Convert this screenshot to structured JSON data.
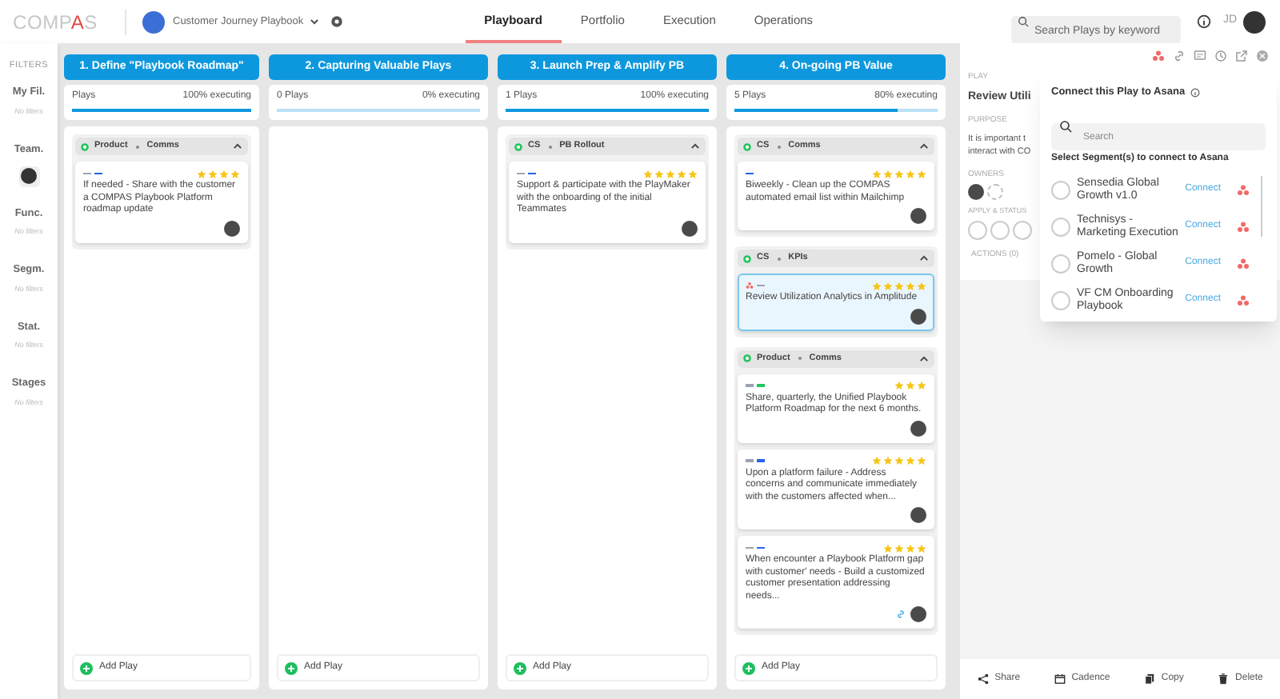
{
  "topbar": {
    "logo": [
      {
        "text": "COMP",
        "accent": false
      },
      {
        "text": "A",
        "accent": true
      },
      {
        "text": "S",
        "accent": false
      }
    ],
    "playbook": "Customer Journey Playbook",
    "tabs": [
      {
        "label": "Playboard",
        "selected": true
      },
      {
        "label": "Portfolio",
        "selected": false
      },
      {
        "label": "Execution",
        "selected": false
      },
      {
        "label": "Operations",
        "selected": false
      }
    ],
    "search": {
      "placeholder": "Search Plays by keyword"
    },
    "user_initials": "JD"
  },
  "filters": {
    "title": "FILTERS",
    "sections": [
      {
        "label": "My Fil.",
        "value": "No filters",
        "kind": "text"
      },
      {
        "label": "Team.",
        "kind": "avatar"
      },
      {
        "label": "Func.",
        "value": "No filters",
        "kind": "text"
      },
      {
        "label": "Segm.",
        "value": "No filters",
        "kind": "text"
      },
      {
        "label": "Stat.",
        "value": "No filters",
        "kind": "text"
      },
      {
        "label": "Stages",
        "value": "No filters",
        "kind": "text"
      }
    ]
  },
  "columns": [
    {
      "title": "1. Define \"Playbook Roadmap\"",
      "plays": "Plays",
      "executing": "100% executing",
      "level": 1,
      "add": "Add Play",
      "groups": [
        {
          "team": "Product",
          "area": "Comms",
          "expanded": true,
          "cards": [
            {
              "markers": [
                {
                  "color": "#9ca3af"
                },
                {
                  "color": "#2563eb"
                }
              ],
              "stars": 4,
              "text": "If needed - Share with the customer a COMPAS Playbook Platform roadmap update",
              "selected": false,
              "asana": false,
              "linked": false
            }
          ]
        }
      ]
    },
    {
      "title": "2. Capturing Valuable Plays",
      "plays": "0 Plays",
      "executing": "0% executing",
      "level": 0,
      "add": "Add Play"
    },
    {
      "title": "3. Launch Prep & Amplify PB",
      "plays": "1 Plays",
      "executing": "100% executing",
      "level": 1,
      "add": "Add Play",
      "groups": [
        {
          "team": "CS",
          "area": "PB Rollout",
          "expanded": true,
          "cards": [
            {
              "markers": [
                {
                  "color": "#9ca3af"
                },
                {
                  "color": "#2563eb"
                }
              ],
              "stars": 5,
              "text": "Support & participate with the PlayMaker with the onboarding of the initial Teammates",
              "selected": false,
              "asana": false,
              "linked": false
            }
          ]
        }
      ]
    },
    {
      "title": "4. On-going PB Value",
      "plays": "5 Plays",
      "executing": "80% executing",
      "level": 0.8,
      "add": "Add Play",
      "groups": [
        {
          "team": "CS",
          "area": "Comms",
          "expanded": true,
          "cards": [
            {
              "markers": [
                {
                  "color": "#2563eb"
                }
              ],
              "stars": 5,
              "text": "Biweekly - Clean up the COMPAS automated email list within Mailchimp",
              "selected": false,
              "asana": false,
              "linked": false
            }
          ]
        },
        {
          "team": "CS",
          "area": "KPIs",
          "expanded": true,
          "cards": [
            {
              "markers": [
                {
                  "color": "#9ca3af"
                }
              ],
              "stars": 5,
              "text": "Review Utilization Analytics in Amplitude",
              "selected": true,
              "asana": true,
              "linked": false
            }
          ]
        },
        {
          "team": "Product",
          "area": "Comms",
          "expanded": true,
          "cards": [
            {
              "markers": [
                {
                  "color": "#9ca3af"
                },
                {
                  "color": "#22c55e"
                }
              ],
              "stars": 3,
              "text": "Share, quarterly, the Unified Playbook Platform Roadmap for the next 6 months.",
              "selected": false,
              "asana": false,
              "linked": false
            },
            {
              "markers": [
                {
                  "color": "#9ca3af"
                },
                {
                  "color": "#2563eb"
                }
              ],
              "stars": 5,
              "text": "Upon a platform failure - Address concerns and communicate immediately with the customers affected when...",
              "selected": false,
              "asana": false,
              "linked": false
            },
            {
              "markers": [
                {
                  "color": "#9ca3af"
                },
                {
                  "color": "#2563eb"
                }
              ],
              "stars": 4,
              "text": "When encounter a Playbook Platform gap with customer' needs - Build a customized customer presentation addressing needs...",
              "selected": false,
              "asana": false,
              "linked": true
            }
          ]
        }
      ]
    }
  ],
  "detail": {
    "play_label": "PLAY",
    "play_title": "Review Utili",
    "purpose_label": "PURPOSE",
    "purpose_lines": [
      "It is important t",
      "interact with CO"
    ],
    "owners_label": "OWNERS",
    "apply_label": "APPLY & STATUS",
    "actions_label": "ACTIONS (0)",
    "footer": [
      {
        "label": "Share",
        "kind": "share"
      },
      {
        "label": "Cadence",
        "kind": "calendar"
      },
      {
        "label": "Copy",
        "kind": "copy"
      },
      {
        "label": "Delete",
        "kind": "delete"
      }
    ]
  },
  "asana_popup": {
    "title": "Connect this Play to Asana",
    "search": {
      "placeholder": "Search"
    },
    "subtitle": "Select Segment(s) to connect to Asana",
    "segments": [
      {
        "name": "Sensedia Global Growth v1.0",
        "action": "Connect"
      },
      {
        "name": "Technisys - Marketing Execution",
        "action": "Connect"
      },
      {
        "name": "Pomelo - Global Growth",
        "action": "Connect"
      },
      {
        "name": "VF CM Onboarding Playbook",
        "action": "Connect"
      }
    ]
  }
}
